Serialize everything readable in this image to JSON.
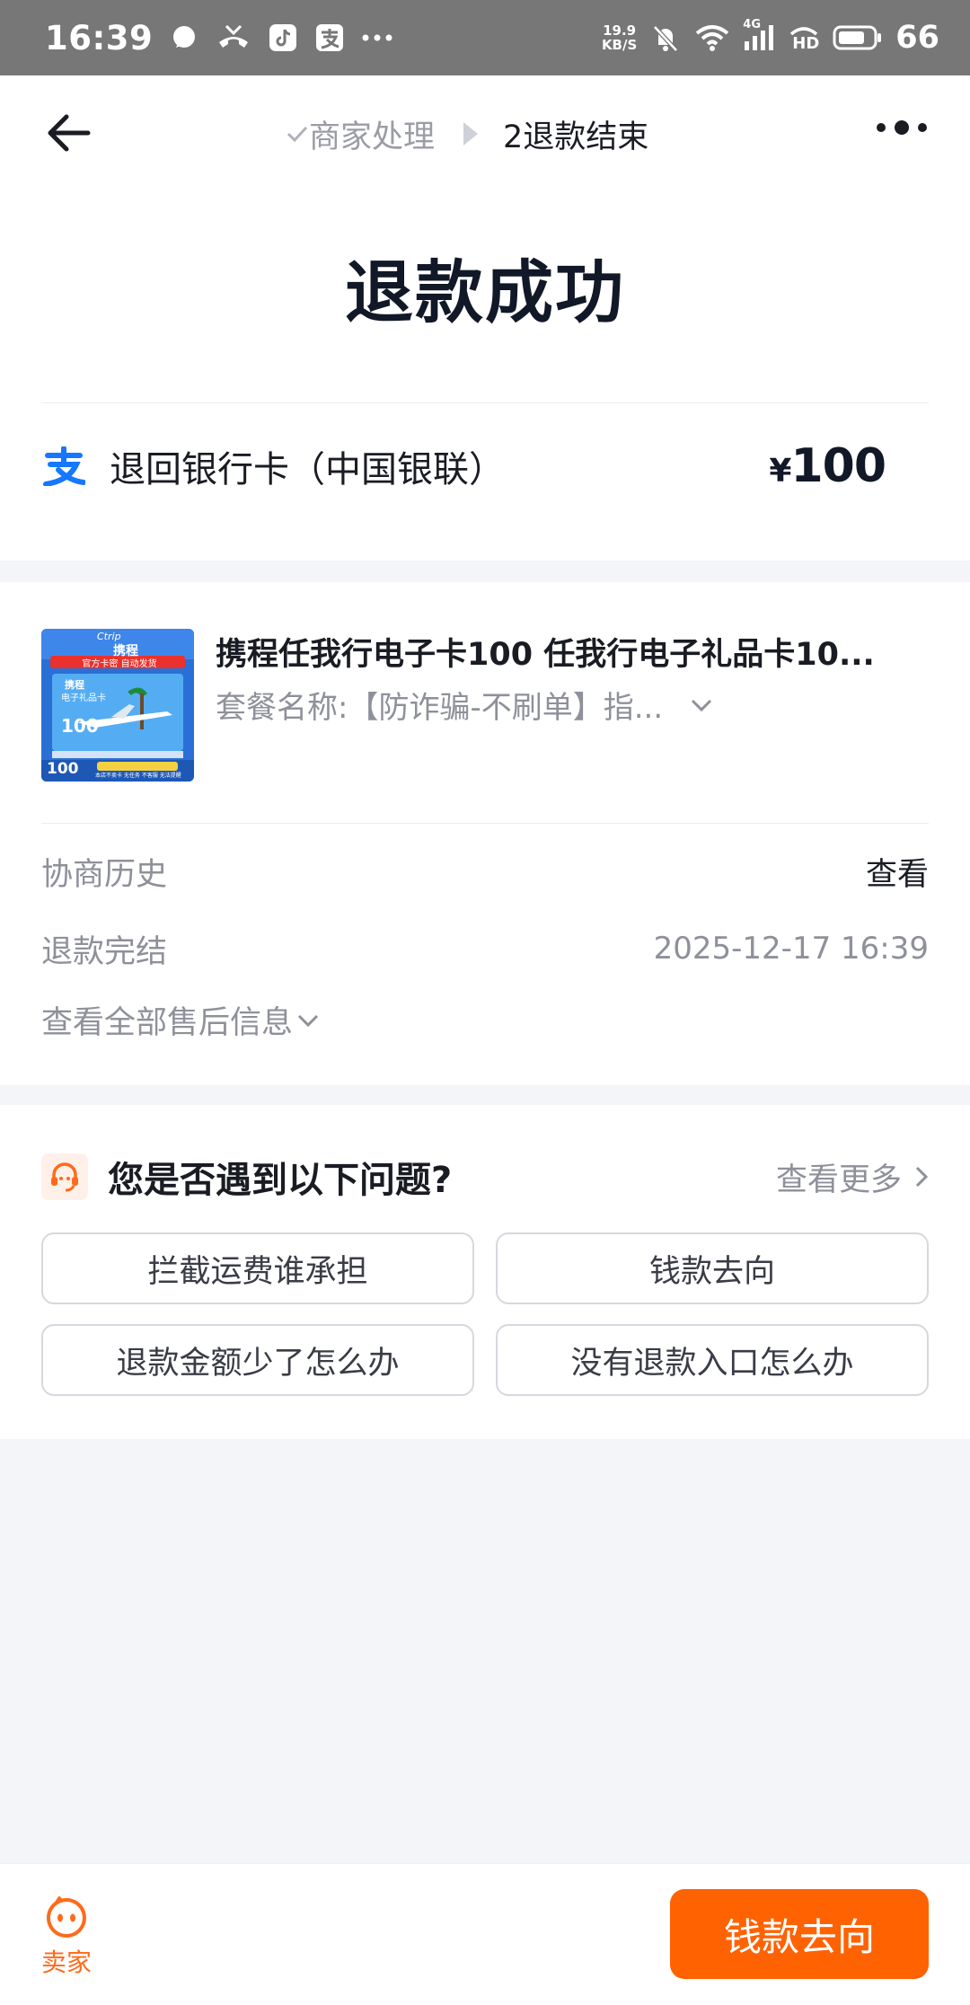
{
  "status_bar": {
    "time": "16:39",
    "net_speed_value": "19.9",
    "net_speed_unit": "KB/S",
    "signal_type": "4G",
    "hd_label": "HD",
    "battery": "66"
  },
  "header": {
    "step_done": "商家处理",
    "step_current": "2退款结束"
  },
  "title": "退款成功",
  "refund": {
    "method": "退回银行卡（中国银联）",
    "currency": "¥",
    "amount": "100"
  },
  "product": {
    "name": "携程任我行电子卡100 任我行电子礼品卡10...",
    "spec": "套餐名称:【防诈骗-不刷单】指...",
    "thumb": {
      "brand": "携程",
      "brand_en": "Ctrip",
      "banner": "官方卡密 自动发货",
      "card_name": "电子礼品卡",
      "value": "100",
      "footer": "本店不卖卡 无任务 不客服 无法提醒"
    }
  },
  "info": {
    "history_label": "协商历史",
    "history_value": "查看",
    "done_label": "退款完结",
    "done_value": "2025-12-17 16:39",
    "expand_label": "查看全部售后信息"
  },
  "faq": {
    "title": "您是否遇到以下问题?",
    "more": "查看更多",
    "items": [
      "拦截运费谁承担",
      "钱款去向",
      "退款金额少了怎么办",
      "没有退款入口怎么办"
    ]
  },
  "bottom": {
    "seller_label": "卖家",
    "main_button": "钱款去向"
  },
  "colors": {
    "accent": "#ff6200",
    "alipay_blue": "#1677ff",
    "status_bar": "#777777"
  }
}
